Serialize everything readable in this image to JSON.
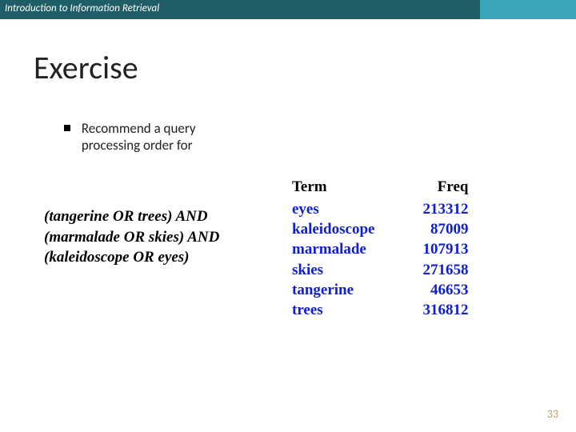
{
  "header": {
    "title": "Introduction to Information Retrieval"
  },
  "slide": {
    "title": "Exercise"
  },
  "bullet": {
    "text": "Recommend a query processing order for"
  },
  "query": {
    "line1": "(tangerine OR trees) AND",
    "line2": "(marmalade OR skies) AND",
    "line3": "(kaleidoscope OR eyes)"
  },
  "table": {
    "head_term": "Term",
    "head_freq": "Freq",
    "rows": [
      {
        "term": "eyes",
        "freq": "213312"
      },
      {
        "term": "kaleidoscope",
        "freq": "87009"
      },
      {
        "term": "marmalade",
        "freq": "107913"
      },
      {
        "term": "skies",
        "freq": "271658"
      },
      {
        "term": "tangerine",
        "freq": "46653"
      },
      {
        "term": "trees",
        "freq": "316812"
      }
    ]
  },
  "page": {
    "num": "33"
  },
  "chart_data": {
    "type": "table",
    "title": "Exercise",
    "columns": [
      "Term",
      "Freq"
    ],
    "rows": [
      [
        "eyes",
        213312
      ],
      [
        "kaleidoscope",
        87009
      ],
      [
        "marmalade",
        107913
      ],
      [
        "skies",
        271658
      ],
      [
        "tangerine",
        46653
      ],
      [
        "trees",
        316812
      ]
    ]
  }
}
